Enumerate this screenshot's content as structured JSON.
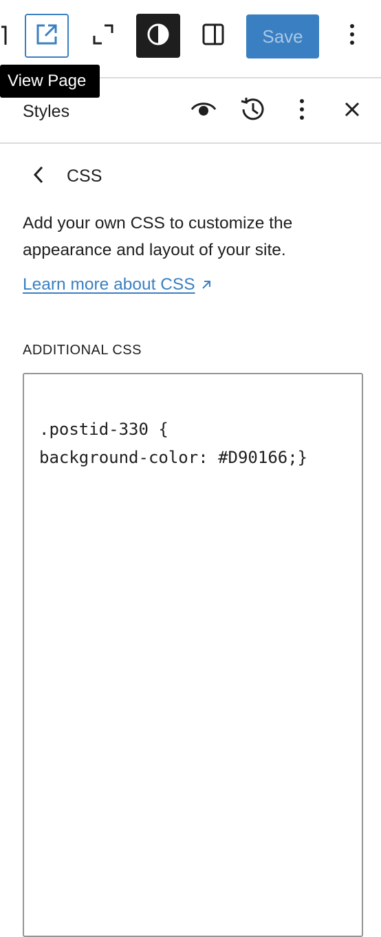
{
  "toolbar": {
    "clipped_icon": "partially-visible-icon",
    "view_page_icon": "external-link-icon",
    "fullscreen_icon": "fullscreen-icon",
    "contrast_icon": "contrast-icon",
    "sidebar_icon": "sidebar-toggle-icon",
    "save_label": "Save",
    "more_icon": "vertical-ellipsis-icon"
  },
  "tooltip": {
    "text": "View Page"
  },
  "styles_header": {
    "title": "Styles",
    "icons": [
      "eye-icon",
      "history-icon",
      "vertical-ellipsis-icon",
      "close-icon"
    ]
  },
  "css_panel": {
    "back_icon": "chevron-left-icon",
    "title": "CSS",
    "description": "Add your own CSS to customize the appearance and layout of your site.",
    "learn_more_link": "Learn more about CSS",
    "learn_more_icon": "arrow-up-right-icon",
    "section_label": "ADDITIONAL CSS",
    "css_value": ".postid-330 {\nbackground-color: #D90166;}"
  },
  "colors": {
    "accent": "#3a7fc1",
    "save_text": "#a9c8e6",
    "dark": "#1e1e1e",
    "border": "#dcdcde"
  }
}
